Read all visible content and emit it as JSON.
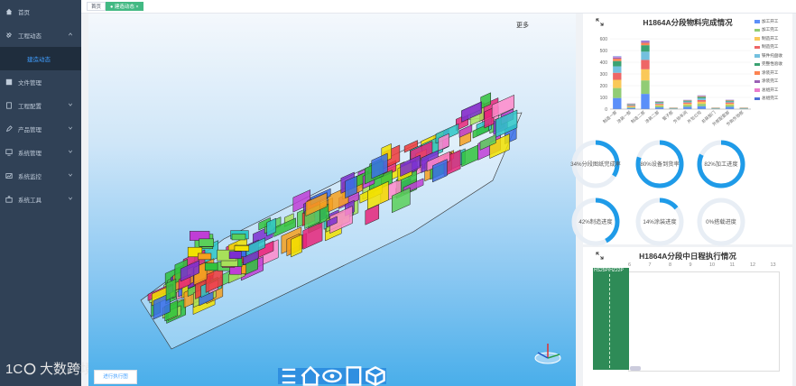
{
  "sidebar": {
    "items": [
      {
        "label": "首页",
        "icon": "home-icon"
      },
      {
        "label": "工程动态",
        "icon": "tool-icon",
        "expanded": true
      },
      {
        "label": "建造动态",
        "sub": true
      },
      {
        "label": "文件管理",
        "icon": "file-icon"
      },
      {
        "label": "工程配置",
        "icon": "document-icon"
      },
      {
        "label": "产品管理",
        "icon": "edit-icon"
      },
      {
        "label": "系统管理",
        "icon": "monitor-icon"
      },
      {
        "label": "系统监控",
        "icon": "chart-icon"
      },
      {
        "label": "系统工具",
        "icon": "toolbox-icon"
      }
    ]
  },
  "tabs": [
    {
      "label": "首页",
      "active": false
    },
    {
      "label": "● 建造动态 ×",
      "active": true
    }
  ],
  "viewer": {
    "more_label": "更多",
    "exec_button": "进行执行图"
  },
  "watermark": {
    "text": "大数跨境",
    "logo_text": "1C0"
  },
  "panel_materials": {
    "title": "H1864A分段物料完成情况",
    "legend": [
      {
        "name": "加工开工",
        "color": "#5b8ff9"
      },
      {
        "name": "加工完工",
        "color": "#91cc75"
      },
      {
        "name": "制造开工",
        "color": "#fac858"
      },
      {
        "name": "制造完工",
        "color": "#ee6666"
      },
      {
        "name": "铁件托盘收",
        "color": "#73c0de"
      },
      {
        "name": "完整性验收",
        "color": "#3ba272"
      },
      {
        "name": "涂装开工",
        "color": "#fc8452"
      },
      {
        "name": "涂装完工",
        "color": "#9a60b4"
      },
      {
        "name": "总组开工",
        "color": "#ea7ccc"
      },
      {
        "name": "总组完工",
        "color": "#4a6fd6"
      }
    ]
  },
  "chart_data": {
    "type": "bar",
    "stacked": true,
    "categories": [
      "制造一部",
      "涂装一部",
      "制造二部",
      "涂装二部",
      "管子部",
      "外协车间",
      "外包公司",
      "总装部门",
      "外部配套部",
      "外购外协部"
    ],
    "ylim": [
      0,
      600
    ],
    "yticks": [
      0,
      100,
      200,
      300,
      400,
      500,
      600
    ],
    "series": [
      {
        "name": "加工开工",
        "values": [
          95,
          10,
          130,
          15,
          5,
          20,
          25,
          5,
          20,
          5
        ]
      },
      {
        "name": "加工完工",
        "values": [
          85,
          8,
          115,
          12,
          3,
          15,
          20,
          3,
          15,
          3
        ]
      },
      {
        "name": "制造开工",
        "values": [
          70,
          7,
          95,
          10,
          2,
          12,
          18,
          2,
          12,
          2
        ]
      },
      {
        "name": "制造完工",
        "values": [
          60,
          6,
          80,
          8,
          2,
          10,
          15,
          2,
          10,
          2
        ]
      },
      {
        "name": "铁件托盘收",
        "values": [
          55,
          5,
          70,
          8,
          1,
          8,
          15,
          1,
          8,
          1
        ]
      },
      {
        "name": "完整性验收",
        "values": [
          45,
          5,
          55,
          7,
          1,
          7,
          12,
          1,
          7,
          1
        ]
      },
      {
        "name": "涂装开工",
        "values": [
          20,
          3,
          20,
          3,
          0,
          3,
          5,
          0,
          4,
          0
        ]
      },
      {
        "name": "涂装完工",
        "values": [
          10,
          2,
          10,
          2,
          0,
          2,
          3,
          0,
          2,
          0
        ]
      },
      {
        "name": "总组开工",
        "values": [
          5,
          1,
          5,
          1,
          0,
          1,
          2,
          0,
          1,
          0
        ]
      },
      {
        "name": "总组完工",
        "values": [
          5,
          1,
          5,
          1,
          0,
          1,
          2,
          0,
          1,
          0
        ]
      }
    ]
  },
  "gauges": [
    {
      "label": "34%分段图纸完成率",
      "value": 34
    },
    {
      "label": "80%设备到货率",
      "value": 80
    },
    {
      "label": "82%加工进度",
      "value": 82
    },
    {
      "label": "42%制造进度",
      "value": 42
    },
    {
      "label": "14%涂装进度",
      "value": 14
    },
    {
      "label": "0%搭载进度",
      "value": 0
    }
  ],
  "gauge_colors": {
    "fill": "#1f9be8",
    "track": "#e8eef5"
  },
  "panel_schedule": {
    "title": "H1864A分段中日程执行情况",
    "axis_ticks": [
      "6",
      "7",
      "8",
      "9",
      "10",
      "11",
      "12",
      "13"
    ],
    "row_label": "HS25P/HZ22P",
    "bar_color": "#2e8b57"
  }
}
